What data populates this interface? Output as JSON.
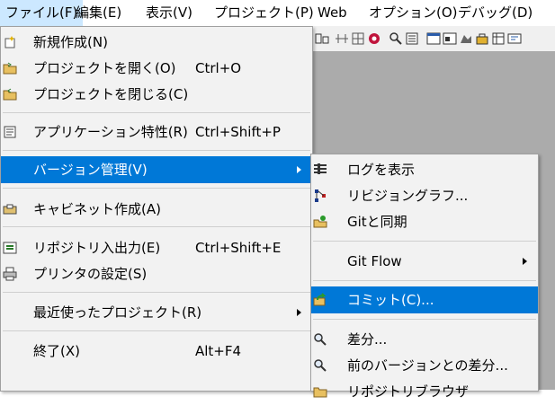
{
  "menubar": {
    "file": "ファイル(F)",
    "edit": "編集(E)",
    "view": "表示(V)",
    "project": "プロジェクト(P)",
    "web": "Web",
    "options": "オプション(O)",
    "debug": "デバッグ(D)"
  },
  "file_menu": {
    "new": "新規作成(N)",
    "open_project": "プロジェクトを開く(O)",
    "open_shortcut": "Ctrl+O",
    "close_project": "プロジェクトを閉じる(C)",
    "app_props": "アプリケーション特性(R)",
    "app_props_shortcut": "Ctrl+Shift+P",
    "version_control": "バージョン管理(V)",
    "cabinet": "キャビネット作成(A)",
    "repo_io": "リポジトリ入出力(E)",
    "repo_io_shortcut": "Ctrl+Shift+E",
    "printer": "プリンタの設定(S)",
    "recent": "最近使ったプロジェクト(R)",
    "exit": "終了(X)",
    "exit_shortcut": "Alt+F4"
  },
  "vc_menu": {
    "show_log": "ログを表示",
    "revision_graph": "リビジョングラフ...",
    "git_sync": "Gitと同期",
    "git_flow": "Git Flow",
    "commit": "コミット(C)...",
    "diff": "差分...",
    "diff_prev": "前のバージョンとの差分...",
    "repo_browser": "リポジトリブラウザ"
  },
  "colors": {
    "highlight": "#0078d7",
    "menu_bg": "#f2f2f2",
    "workspace": "#ababab"
  }
}
